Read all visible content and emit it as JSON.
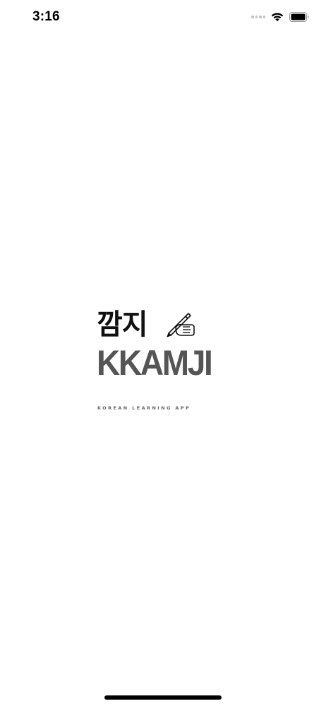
{
  "status_bar": {
    "time": "3:16",
    "icons": [
      "signal-icon",
      "wifi-icon",
      "battery-icon"
    ]
  },
  "logo": {
    "korean_title": "깜지",
    "english_title": "KKAMJI",
    "tagline": "KOREAN LEARNING APP",
    "icon": "writing-hand-icon"
  },
  "colors": {
    "background": "#ffffff",
    "korean_title": "#111111",
    "english_title": "#555555",
    "tagline": "#666666"
  }
}
